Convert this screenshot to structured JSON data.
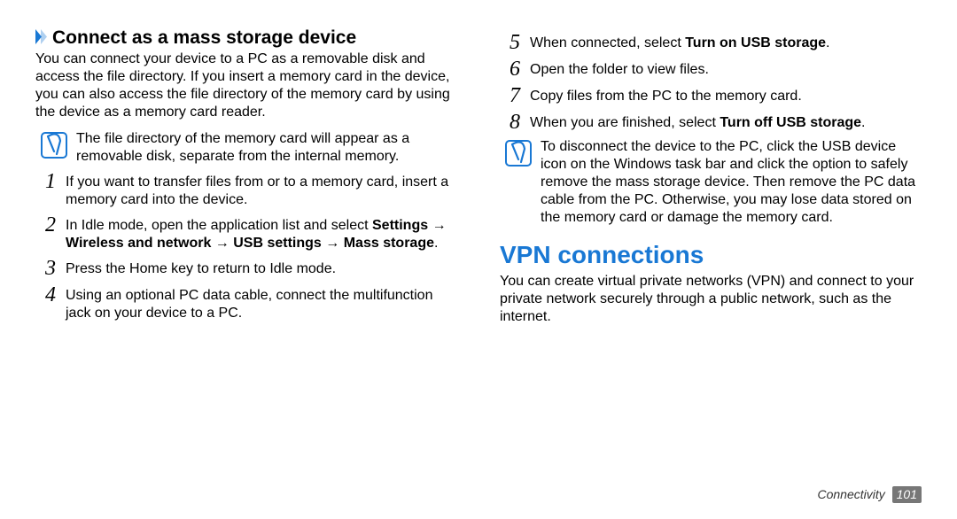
{
  "left": {
    "heading": "Connect as a mass storage device",
    "intro": "You can connect your device to a PC as a removable disk and access the file directory. If you insert a memory card in the device, you can also access the file directory of the memory card by using the device as a memory card reader.",
    "note": "The file directory of the memory card will appear as a removable disk, separate from the internal memory.",
    "steps": [
      {
        "n": "1",
        "html": "If you want to transfer files from or to a memory card, insert a memory card into the device."
      },
      {
        "n": "2",
        "html": "In Idle mode, open the application list and select <b>Settings</b> → <b>Wireless and network</b> → <b>USB settings</b> → <b>Mass storage</b>."
      },
      {
        "n": "3",
        "html": "Press the Home key to return to Idle mode."
      },
      {
        "n": "4",
        "html": "Using an optional PC data cable, connect the multifunction jack on your device to a PC."
      }
    ]
  },
  "right": {
    "steps": [
      {
        "n": "5",
        "html": "When connected, select <b>Turn on USB storage</b>."
      },
      {
        "n": "6",
        "html": "Open the folder to view files."
      },
      {
        "n": "7",
        "html": "Copy files from the PC to the memory card."
      },
      {
        "n": "8",
        "html": "When you are finished, select <b>Turn off USB storage</b>."
      }
    ],
    "note": "To disconnect the device to the PC, click the USB device icon on the Windows task bar and click the option to safely remove the mass storage device. Then remove the PC data cable from the PC. Otherwise, you may lose data stored on the memory card or damage the memory card.",
    "section_title": "VPN connections",
    "section_intro": "You can create virtual private networks (VPN) and connect to your private network securely through a public network, such as the internet."
  },
  "footer": {
    "section": "Connectivity",
    "page": "101"
  }
}
